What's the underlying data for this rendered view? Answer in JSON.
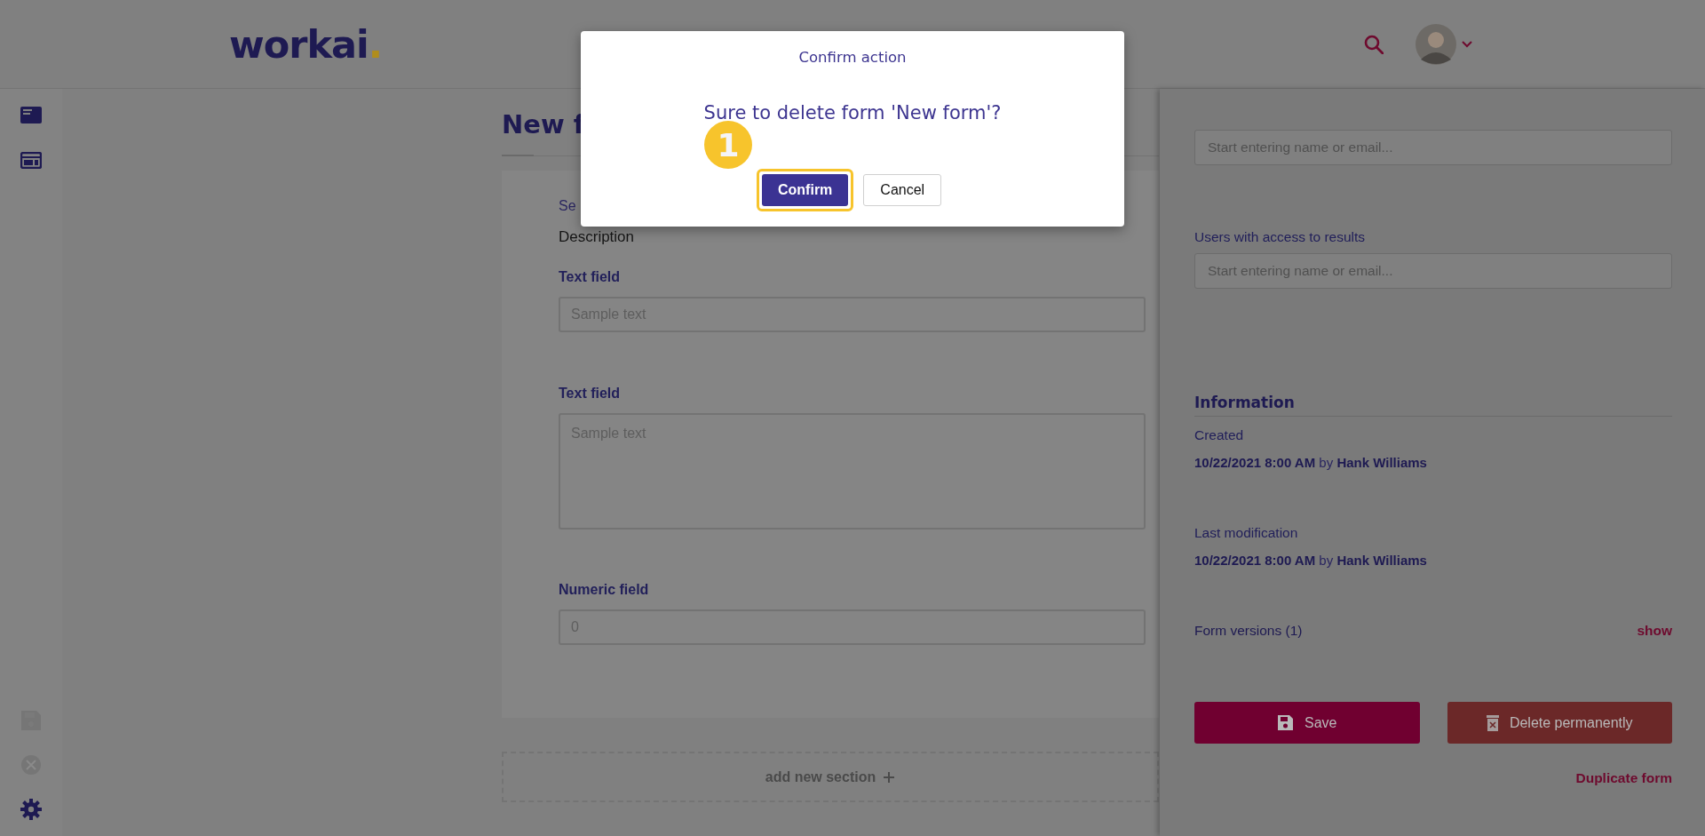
{
  "header": {
    "logo": {
      "text": "workai",
      "accent": "."
    }
  },
  "sidebar": {
    "items": [
      {
        "kind": "document",
        "disabled": false
      },
      {
        "kind": "layout",
        "disabled": false
      },
      {
        "kind": "save",
        "disabled": true
      },
      {
        "kind": "cancel",
        "disabled": true
      },
      {
        "kind": "settings",
        "disabled": false
      }
    ]
  },
  "form": {
    "title": "New f",
    "section": {
      "title": "Se",
      "description": "Description",
      "fields": [
        {
          "kind": "text",
          "label": "Text field",
          "placeholder": "Sample text"
        },
        {
          "kind": "textarea",
          "label": "Text field",
          "placeholder": "Sample text"
        },
        {
          "kind": "number",
          "label": "Numeric field",
          "placeholder": "0"
        }
      ]
    },
    "add_section": "add new section"
  },
  "panel": {
    "fields": [
      {
        "placeholder": "Start entering name or email..."
      },
      {
        "label": "Users with access to results",
        "placeholder": "Start entering name or email..."
      }
    ],
    "information": {
      "heading": "Information",
      "entries": [
        {
          "label": "Created",
          "value": "**10/22/2021 8:00 AM** by **Hank Williams**"
        },
        {
          "label": "Last modification",
          "value": "**10/22/2021 8:00 AM** by **Hank Williams**"
        }
      ]
    },
    "versions": {
      "label": "Form versions (1)",
      "action": "show"
    },
    "buttons": [
      {
        "kind": "save",
        "label": "Save"
      },
      {
        "kind": "delete",
        "label": "Delete permanently"
      }
    ],
    "duplicate": "Duplicate form"
  },
  "dialog": {
    "title": "Confirm action",
    "message": "Sure to delete form 'New form'?",
    "step_badge": "1",
    "buttons": [
      {
        "kind": "primary",
        "label": "Confirm",
        "highlighted": true
      },
      {
        "kind": "secondary",
        "label": "Cancel",
        "highlighted": false
      }
    ]
  }
}
